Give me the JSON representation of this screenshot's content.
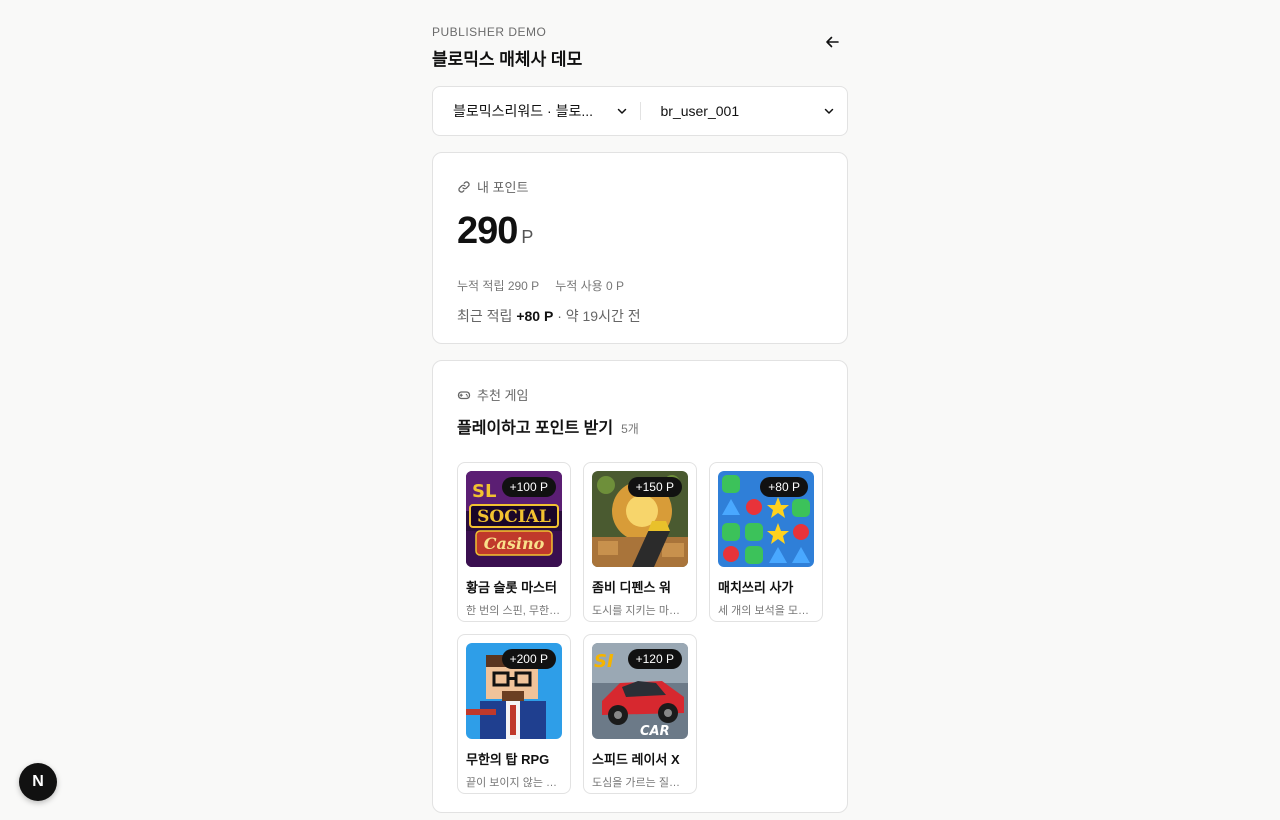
{
  "header": {
    "eyebrow": "PUBLISHER DEMO",
    "title": "블로믹스 매체사 데모",
    "back_icon": "arrow-left-icon"
  },
  "selectors": {
    "publisher": "블로믹스리워드 · 블로...",
    "user": "br_user_001"
  },
  "points": {
    "label": "내 포인트",
    "value": "290",
    "unit": "P",
    "accumulated": "누적 적립 290 P",
    "used": "누적 사용 0 P",
    "recent_prefix": "최근 적립",
    "recent_amount": "+80 P",
    "recent_suffix": "· 약 19시간 전"
  },
  "games_section": {
    "label": "추천 게임",
    "title": "플레이하고 포인트 받기",
    "count": "5개",
    "items": [
      {
        "badge": "+100 P",
        "name": "황금 슬롯 마스터",
        "desc": "한 번의 스핀, 무한한 행운",
        "thumb": "social-casino"
      },
      {
        "badge": "+150 P",
        "name": "좀비 디펜스 워",
        "desc": "도시를 지키는 마지막 방어선",
        "thumb": "zombie-defense"
      },
      {
        "badge": "+80 P",
        "name": "매치쓰리 사가",
        "desc": "세 개의 보석을 모아라",
        "thumb": "match-three"
      },
      {
        "badge": "+200 P",
        "name": "무한의 탑 RPG",
        "desc": "끝이 보이지 않는 탑을 올라라",
        "thumb": "pixel-rpg"
      },
      {
        "badge": "+120 P",
        "name": "스피드 레이서 X",
        "desc": "도심을 가르는 질주 본능",
        "thumb": "racing-car"
      }
    ]
  },
  "fab": {
    "label": "N"
  },
  "colors": {
    "accent": "#111111",
    "background": "#f9f9f8"
  }
}
